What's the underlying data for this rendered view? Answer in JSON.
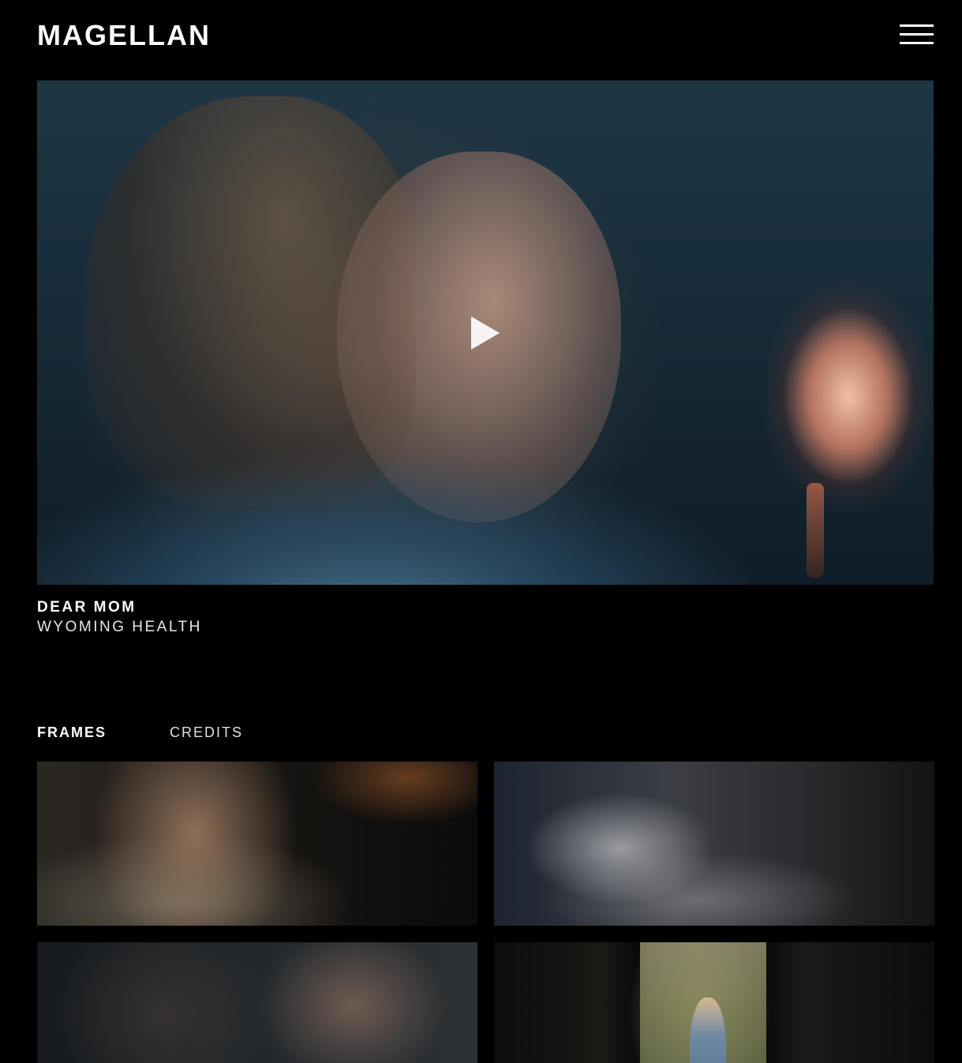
{
  "header": {
    "logo": "MAGELLAN",
    "menu_icon": "hamburger-menu-icon"
  },
  "hero": {
    "play_icon": "play-icon",
    "title": "DEAR MOM",
    "client": "WYOMING HEALTH"
  },
  "tabs": [
    {
      "label": "FRAMES",
      "active": true
    },
    {
      "label": "CREDITS",
      "active": false
    }
  ],
  "frames": [
    {
      "name": "frame-woman-driving"
    },
    {
      "name": "frame-hospital-corridor"
    },
    {
      "name": "frame-hallway-argument"
    },
    {
      "name": "frame-doorway-garden"
    }
  ],
  "colors": {
    "background": "#000000",
    "text": "#ffffff"
  }
}
